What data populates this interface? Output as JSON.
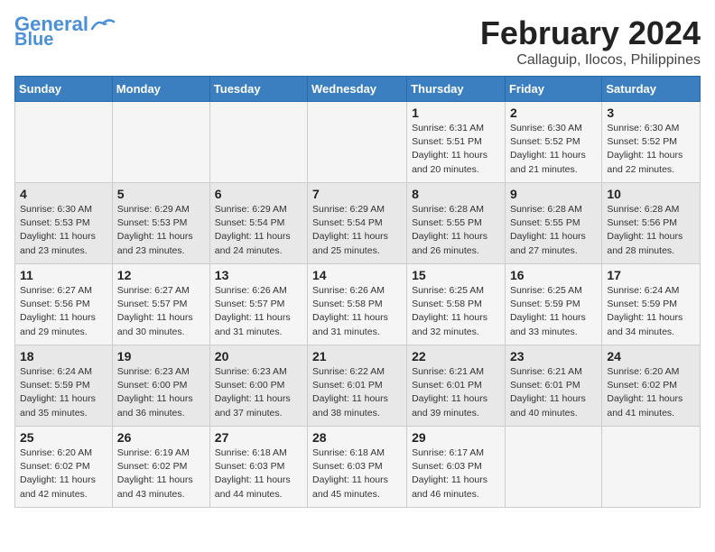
{
  "header": {
    "logo_line1": "General",
    "logo_line2": "Blue",
    "title": "February 2024",
    "subtitle": "Callaguip, Ilocos, Philippines"
  },
  "days_of_week": [
    "Sunday",
    "Monday",
    "Tuesday",
    "Wednesday",
    "Thursday",
    "Friday",
    "Saturday"
  ],
  "weeks": [
    [
      {
        "day": "",
        "info": ""
      },
      {
        "day": "",
        "info": ""
      },
      {
        "day": "",
        "info": ""
      },
      {
        "day": "",
        "info": ""
      },
      {
        "day": "1",
        "info": "Sunrise: 6:31 AM\nSunset: 5:51 PM\nDaylight: 11 hours\nand 20 minutes."
      },
      {
        "day": "2",
        "info": "Sunrise: 6:30 AM\nSunset: 5:52 PM\nDaylight: 11 hours\nand 21 minutes."
      },
      {
        "day": "3",
        "info": "Sunrise: 6:30 AM\nSunset: 5:52 PM\nDaylight: 11 hours\nand 22 minutes."
      }
    ],
    [
      {
        "day": "4",
        "info": "Sunrise: 6:30 AM\nSunset: 5:53 PM\nDaylight: 11 hours\nand 23 minutes."
      },
      {
        "day": "5",
        "info": "Sunrise: 6:29 AM\nSunset: 5:53 PM\nDaylight: 11 hours\nand 23 minutes."
      },
      {
        "day": "6",
        "info": "Sunrise: 6:29 AM\nSunset: 5:54 PM\nDaylight: 11 hours\nand 24 minutes."
      },
      {
        "day": "7",
        "info": "Sunrise: 6:29 AM\nSunset: 5:54 PM\nDaylight: 11 hours\nand 25 minutes."
      },
      {
        "day": "8",
        "info": "Sunrise: 6:28 AM\nSunset: 5:55 PM\nDaylight: 11 hours\nand 26 minutes."
      },
      {
        "day": "9",
        "info": "Sunrise: 6:28 AM\nSunset: 5:55 PM\nDaylight: 11 hours\nand 27 minutes."
      },
      {
        "day": "10",
        "info": "Sunrise: 6:28 AM\nSunset: 5:56 PM\nDaylight: 11 hours\nand 28 minutes."
      }
    ],
    [
      {
        "day": "11",
        "info": "Sunrise: 6:27 AM\nSunset: 5:56 PM\nDaylight: 11 hours\nand 29 minutes."
      },
      {
        "day": "12",
        "info": "Sunrise: 6:27 AM\nSunset: 5:57 PM\nDaylight: 11 hours\nand 30 minutes."
      },
      {
        "day": "13",
        "info": "Sunrise: 6:26 AM\nSunset: 5:57 PM\nDaylight: 11 hours\nand 31 minutes."
      },
      {
        "day": "14",
        "info": "Sunrise: 6:26 AM\nSunset: 5:58 PM\nDaylight: 11 hours\nand 31 minutes."
      },
      {
        "day": "15",
        "info": "Sunrise: 6:25 AM\nSunset: 5:58 PM\nDaylight: 11 hours\nand 32 minutes."
      },
      {
        "day": "16",
        "info": "Sunrise: 6:25 AM\nSunset: 5:59 PM\nDaylight: 11 hours\nand 33 minutes."
      },
      {
        "day": "17",
        "info": "Sunrise: 6:24 AM\nSunset: 5:59 PM\nDaylight: 11 hours\nand 34 minutes."
      }
    ],
    [
      {
        "day": "18",
        "info": "Sunrise: 6:24 AM\nSunset: 5:59 PM\nDaylight: 11 hours\nand 35 minutes."
      },
      {
        "day": "19",
        "info": "Sunrise: 6:23 AM\nSunset: 6:00 PM\nDaylight: 11 hours\nand 36 minutes."
      },
      {
        "day": "20",
        "info": "Sunrise: 6:23 AM\nSunset: 6:00 PM\nDaylight: 11 hours\nand 37 minutes."
      },
      {
        "day": "21",
        "info": "Sunrise: 6:22 AM\nSunset: 6:01 PM\nDaylight: 11 hours\nand 38 minutes."
      },
      {
        "day": "22",
        "info": "Sunrise: 6:21 AM\nSunset: 6:01 PM\nDaylight: 11 hours\nand 39 minutes."
      },
      {
        "day": "23",
        "info": "Sunrise: 6:21 AM\nSunset: 6:01 PM\nDaylight: 11 hours\nand 40 minutes."
      },
      {
        "day": "24",
        "info": "Sunrise: 6:20 AM\nSunset: 6:02 PM\nDaylight: 11 hours\nand 41 minutes."
      }
    ],
    [
      {
        "day": "25",
        "info": "Sunrise: 6:20 AM\nSunset: 6:02 PM\nDaylight: 11 hours\nand 42 minutes."
      },
      {
        "day": "26",
        "info": "Sunrise: 6:19 AM\nSunset: 6:02 PM\nDaylight: 11 hours\nand 43 minutes."
      },
      {
        "day": "27",
        "info": "Sunrise: 6:18 AM\nSunset: 6:03 PM\nDaylight: 11 hours\nand 44 minutes."
      },
      {
        "day": "28",
        "info": "Sunrise: 6:18 AM\nSunset: 6:03 PM\nDaylight: 11 hours\nand 45 minutes."
      },
      {
        "day": "29",
        "info": "Sunrise: 6:17 AM\nSunset: 6:03 PM\nDaylight: 11 hours\nand 46 minutes."
      },
      {
        "day": "",
        "info": ""
      },
      {
        "day": "",
        "info": ""
      }
    ]
  ]
}
